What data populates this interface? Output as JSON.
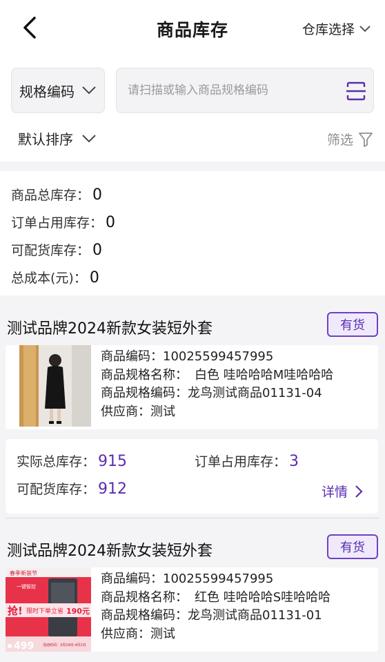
{
  "header": {
    "title": "商品库存",
    "warehouse_label": "仓库选择"
  },
  "search": {
    "spec_type": "规格编码",
    "placeholder": "请扫描或输入商品规格编码",
    "sort_label": "默认排序",
    "filter_label": "筛选"
  },
  "summary": {
    "total_stock": {
      "label": "商品总库存：",
      "value": "0"
    },
    "order_occupied": {
      "label": "订单占用库存：",
      "value": "0"
    },
    "allocatable": {
      "label": "可配货库存：",
      "value": "0"
    },
    "total_cost": {
      "label": "总成本(元)：",
      "value": "0"
    }
  },
  "products": [
    {
      "title": "测试品牌2024新款女装短外套",
      "badge": "有货",
      "code_label": "商品编码：",
      "code": "10025599457995",
      "spec_name_label": "商品规格名称：",
      "spec_name": "白色 哇哈哈哈M哇哈哈哈",
      "spec_code_label": "商品规格编码：",
      "spec_code": "龙鸟测试商品01131-04",
      "supplier_label": "供应商：",
      "supplier": "测试",
      "actual_stock_label": "实际总库存：",
      "actual_stock": "915",
      "order_stock_label": "订单占用库存：",
      "order_stock": "3",
      "alloc_stock_label": "可配货库存：",
      "alloc_stock": "912",
      "detail_label": "详情"
    },
    {
      "title": "测试品牌2024新款女装短外套",
      "badge": "有货",
      "code_label": "商品编码：",
      "code": "10025599457995",
      "spec_name_label": "商品规格名称：",
      "spec_name": "红色 哇哈哈哈S哇哈哈哈",
      "spec_code_label": "商品规格编码：",
      "spec_code": "龙鸟测试商品01131-01",
      "supplier_label": "供应商：",
      "supplier": "测试",
      "promo": {
        "top": "春季新装节",
        "mid": "一键智控",
        "grab": "抢!",
        "slogan": "限时下单立省",
        "amount": "190元",
        "price": "499",
        "date": "活动时间：3月29日-4月2日"
      }
    }
  ],
  "colors": {
    "accent": "#5a2db0",
    "badge_bg": "#efeafb",
    "page_bg": "#f4f4f6"
  }
}
